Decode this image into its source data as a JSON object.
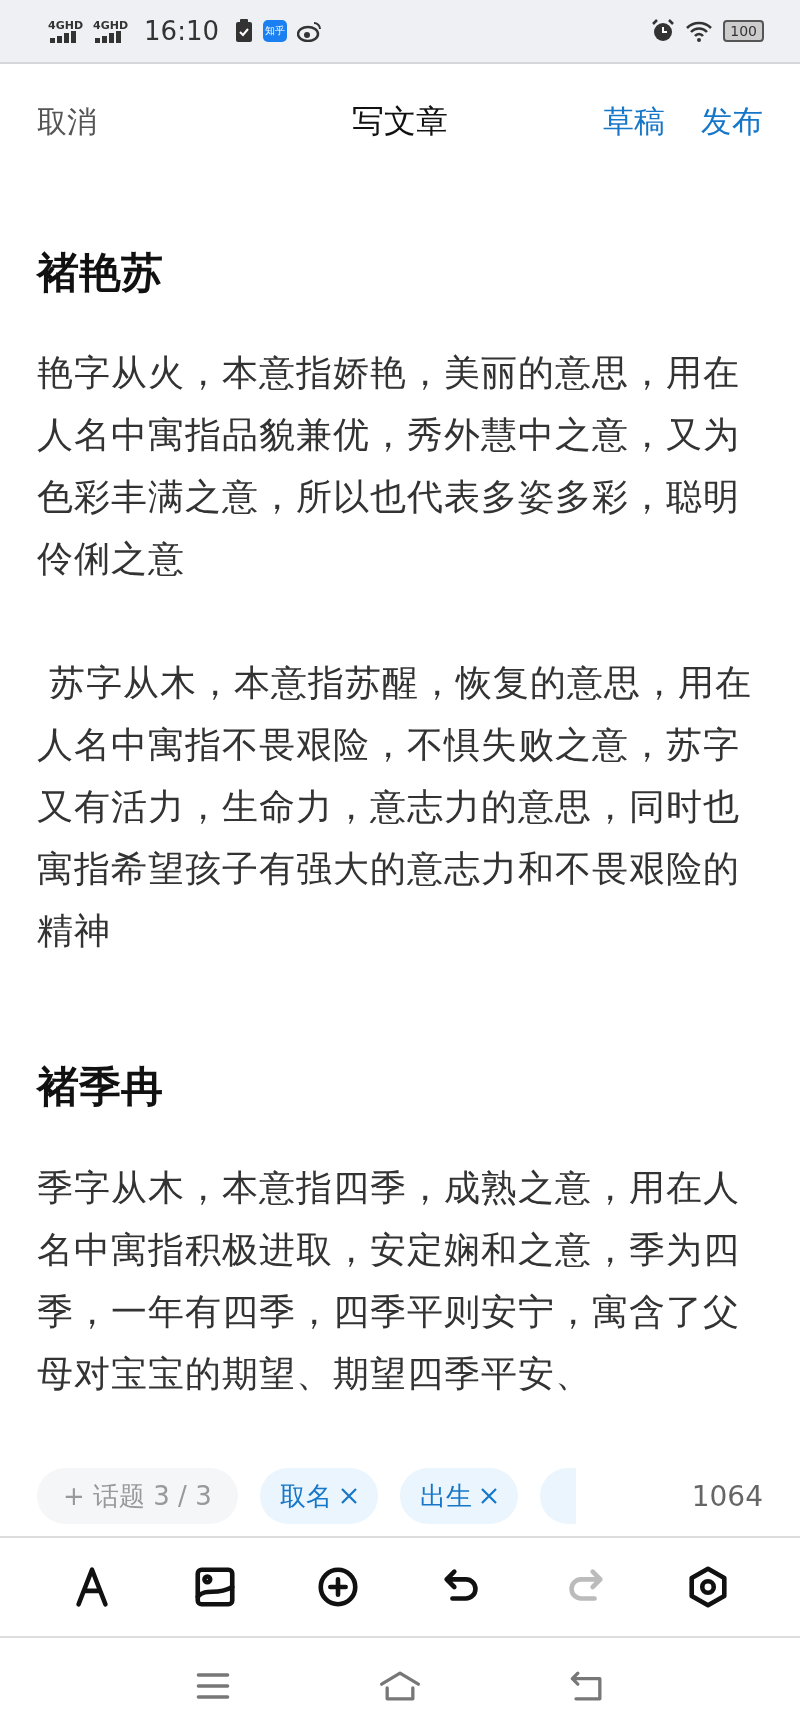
{
  "status_bar": {
    "signals": [
      {
        "network": "4G",
        "badge": "HD"
      },
      {
        "network": "4G",
        "badge": "HD"
      }
    ],
    "time": "16:10",
    "notifications": [
      {
        "kind": "clipboard"
      },
      {
        "kind": "app",
        "label": "知乎"
      },
      {
        "kind": "weibo"
      }
    ],
    "battery": "100"
  },
  "header": {
    "cancel": "取消",
    "title": "写文章",
    "actions": [
      "草稿",
      "发布"
    ]
  },
  "article": [
    {
      "kind": "heading",
      "text": "褚艳苏"
    },
    {
      "kind": "paragraph",
      "text": "艳字从火，本意指娇艳，美丽的意思，用在人名中寓指品貌兼优，秀外慧中之意，又为色彩丰满之意，所以也代表多姿多彩，聪明伶俐之意"
    },
    {
      "kind": "paragraph",
      "text": " 苏字从木，本意指苏醒，恢复的意思，用在人名中寓指不畏艰险，不惧失败之意，苏字又有活力，生命力，意志力的意思，同时也寓指希望孩子有强大的意志力和不畏艰险的精神"
    },
    {
      "kind": "heading",
      "text": "褚季冉"
    },
    {
      "kind": "paragraph",
      "text": "季字从木，本意指四季，成熟之意，用在人名中寓指积极进取，安定娴和之意，季为四季，一年有四季，四季平则安宁，寓含了父母对宝宝的期望、期望四季平安、"
    }
  ],
  "topics": {
    "add_label": "+ 话题 3 / 3",
    "tags": [
      {
        "label": "取名"
      },
      {
        "label": "出生"
      }
    ],
    "word_count": "1064"
  },
  "toolbar": [
    {
      "kind": "text-style",
      "disabled": false
    },
    {
      "kind": "image",
      "disabled": false
    },
    {
      "kind": "insert",
      "disabled": false
    },
    {
      "kind": "undo",
      "disabled": false
    },
    {
      "kind": "redo",
      "disabled": true
    },
    {
      "kind": "settings",
      "disabled": false
    }
  ],
  "nav_bar": [
    {
      "kind": "menu"
    },
    {
      "kind": "home"
    },
    {
      "kind": "back"
    }
  ]
}
